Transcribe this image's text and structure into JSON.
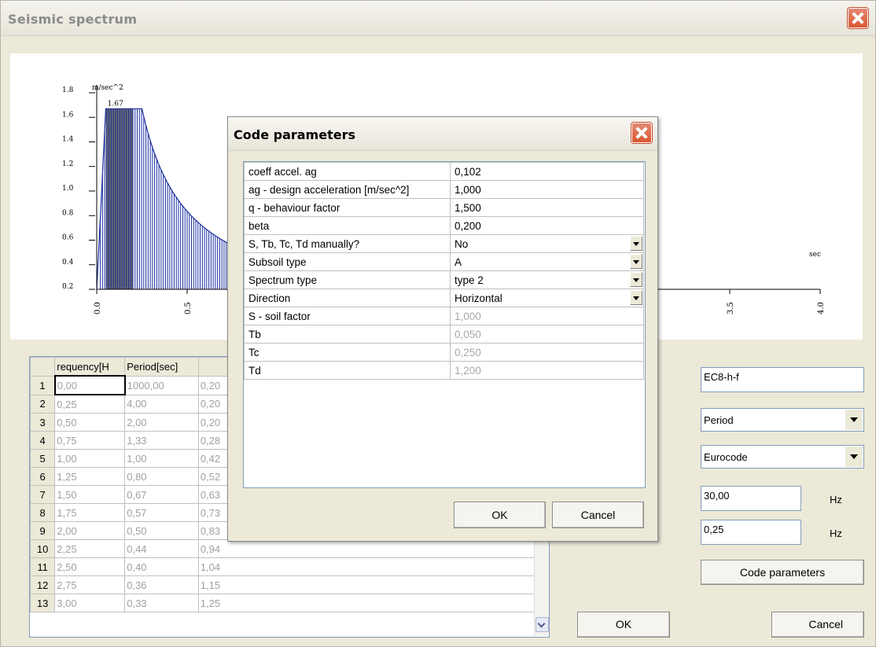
{
  "window": {
    "title": "Seismic spectrum"
  },
  "chart_data": {
    "type": "bar",
    "y_unit": "m/sec^2",
    "x_unit": "sec",
    "y_ticks": [
      "1.8",
      "1.6",
      "1.4",
      "1.2",
      "1.0",
      "0.8",
      "0.6",
      "0.4",
      "0.2"
    ],
    "x_ticks": [
      "0.0",
      "0.5",
      "3.5",
      "4.0"
    ],
    "peak_label": "1.67",
    "peak_value": 1.67,
    "ylim": [
      0.2,
      1.8
    ],
    "xlim": [
      0.0,
      4.0
    ],
    "TB": 0.05,
    "TC": 0.25,
    "highlight_range": [
      0.05,
      0.2
    ]
  },
  "table": {
    "headers": [
      "requency[H",
      "Period[sec]",
      ""
    ],
    "rows": [
      {
        "n": "1",
        "f": "0,00",
        "p": "1000,00",
        "s": "0,20"
      },
      {
        "n": "2",
        "f": "0,25",
        "p": "4,00",
        "s": "0,20"
      },
      {
        "n": "3",
        "f": "0,50",
        "p": "2,00",
        "s": "0,20"
      },
      {
        "n": "4",
        "f": "0,75",
        "p": "1,33",
        "s": "0,28"
      },
      {
        "n": "5",
        "f": "1,00",
        "p": "1,00",
        "s": "0,42"
      },
      {
        "n": "6",
        "f": "1,25",
        "p": "0,80",
        "s": "0,52"
      },
      {
        "n": "7",
        "f": "1,50",
        "p": "0,67",
        "s": "0,63"
      },
      {
        "n": "8",
        "f": "1,75",
        "p": "0,57",
        "s": "0,73"
      },
      {
        "n": "9",
        "f": "2,00",
        "p": "0,50",
        "s": "0,83"
      },
      {
        "n": "10",
        "f": "2,25",
        "p": "0,44",
        "s": "0,94"
      },
      {
        "n": "11",
        "f": "2,50",
        "p": "0,40",
        "s": "1,04"
      },
      {
        "n": "12",
        "f": "2,75",
        "p": "0,36",
        "s": "1,15"
      },
      {
        "n": "13",
        "f": "3,00",
        "p": "0,33",
        "s": "1,25"
      }
    ]
  },
  "controls": {
    "name_value": "EC8-h-f",
    "axis_select": "Period",
    "code_select": "Eurocode",
    "freq_max": "30,00",
    "freq_step": "0,25",
    "unit_hz": "Hz",
    "code_params_button": "Code parameters",
    "ok_button": "OK",
    "cancel_button": "Cancel"
  },
  "dialog": {
    "title": "Code parameters",
    "params": [
      {
        "label": "coeff accel. ag",
        "value": "0,102",
        "dropdown": false,
        "readonly": false
      },
      {
        "label": "ag - design acceleration [m/sec^2]",
        "value": "1,000",
        "dropdown": false,
        "readonly": false
      },
      {
        "label": "q - behaviour factor",
        "value": "1,500",
        "dropdown": false,
        "readonly": false
      },
      {
        "label": "beta",
        "value": "0,200",
        "dropdown": false,
        "readonly": false
      },
      {
        "label": "S, Tb, Tc, Td manually?",
        "value": "No",
        "dropdown": true,
        "readonly": false
      },
      {
        "label": "Subsoil type",
        "value": "A",
        "dropdown": true,
        "readonly": false
      },
      {
        "label": "Spectrum type",
        "value": "type 2",
        "dropdown": true,
        "readonly": false
      },
      {
        "label": "Direction",
        "value": "Horizontal",
        "dropdown": true,
        "readonly": false
      },
      {
        "label": "S - soil factor",
        "value": "1,000",
        "dropdown": false,
        "readonly": true
      },
      {
        "label": "Tb",
        "value": "0,050",
        "dropdown": false,
        "readonly": true
      },
      {
        "label": "Tc",
        "value": "0,250",
        "dropdown": false,
        "readonly": true
      },
      {
        "label": "Td",
        "value": "1,200",
        "dropdown": false,
        "readonly": true
      }
    ],
    "ok_button": "OK",
    "cancel_button": "Cancel"
  }
}
